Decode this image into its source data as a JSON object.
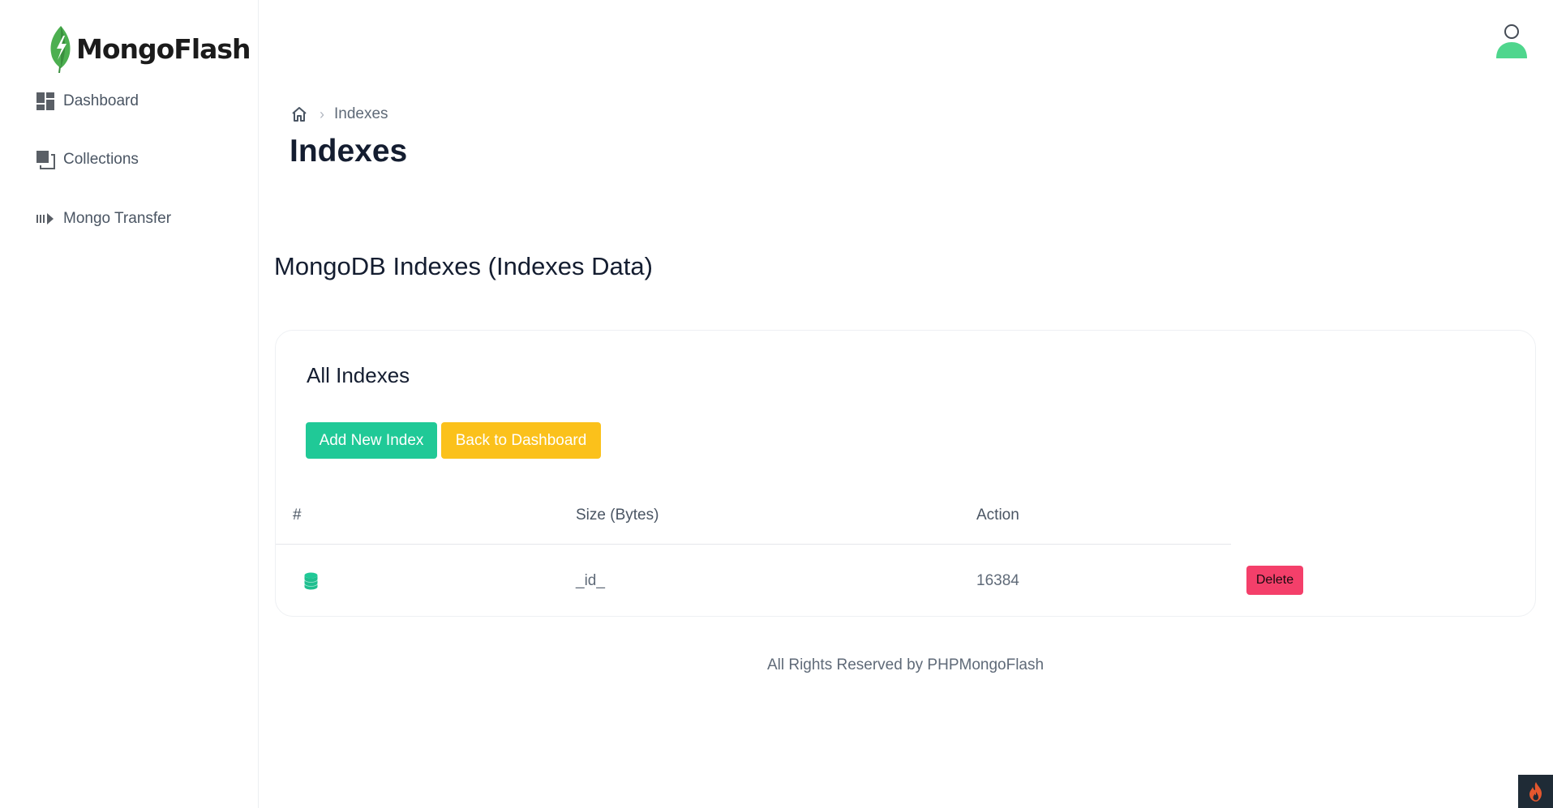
{
  "app": {
    "logo_text": "MongoFlash"
  },
  "sidebar": {
    "items": [
      {
        "label": "Dashboard",
        "icon": "dashboard-icon"
      },
      {
        "label": "Collections",
        "icon": "collections-icon"
      },
      {
        "label": "Mongo Transfer",
        "icon": "transfer-icon"
      }
    ]
  },
  "header": {
    "avatar_icon": "user-icon"
  },
  "breadcrumb": {
    "home_icon": "home-icon",
    "current": "Indexes"
  },
  "page": {
    "title": "Indexes",
    "section_title": "MongoDB Indexes (Indexes Data)"
  },
  "card": {
    "title": "All Indexes",
    "add_button": "Add New Index",
    "back_button": "Back to Dashboard",
    "columns": [
      "#",
      "Size (Bytes)",
      "Action"
    ],
    "rows": [
      {
        "icon": "database-icon",
        "name": "_id_",
        "size": "16384",
        "action": "Delete"
      }
    ]
  },
  "footer": {
    "text": "All Rights Reserved by PHPMongoFlash"
  },
  "colors": {
    "primary": "#20c997",
    "warning": "#fbc11b",
    "danger": "#f43f6a",
    "badge_bg": "#1f2b36"
  }
}
